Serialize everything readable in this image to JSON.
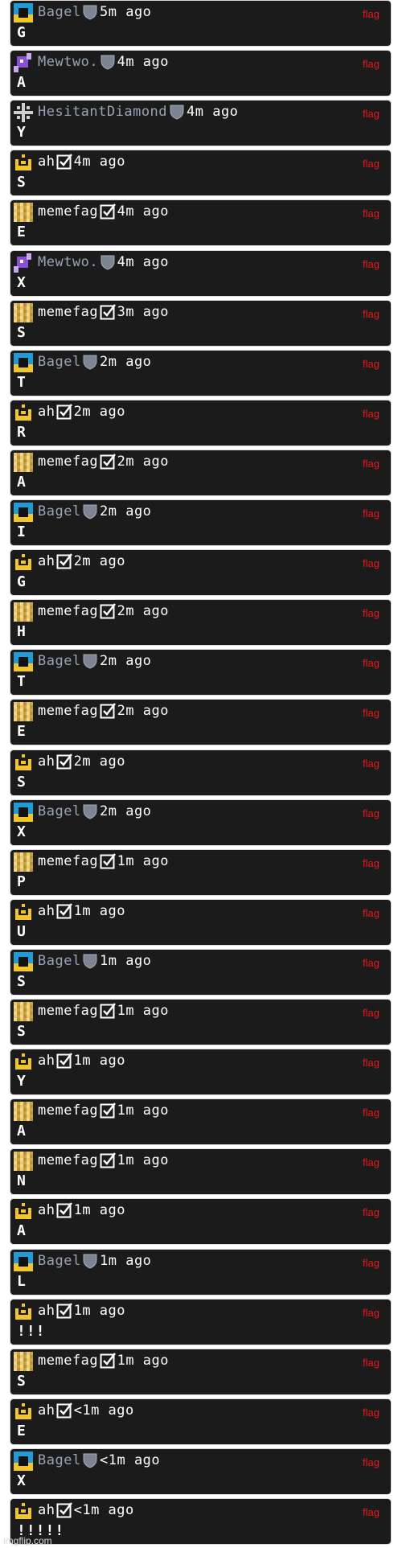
{
  "flag_label": "flag",
  "watermark": "imgflip.com",
  "colors": {
    "row_bg": "#1b1b1c",
    "row_border": "#d9d9d9",
    "flag": "#e61a1a",
    "anon_name": "#9aa3b5",
    "verified_name": "#ffffff",
    "bagel_avatar": "#1f9bd8",
    "crown_avatar": "#f2c52b",
    "memefag_avatar": "#d9b24a",
    "mewtwo_avatar": "#8a4fd8"
  },
  "messages": [
    {
      "user": "Bagel",
      "avatar": "bagel-icon",
      "badge": "shield-icon",
      "time": "5m ago",
      "text": "G"
    },
    {
      "user": "Mewtwo.",
      "avatar": "mewtwo-icon",
      "badge": "shield-icon",
      "time": "4m ago",
      "text": "A"
    },
    {
      "user": "HesitantDiamond",
      "avatar": "diamond-cross-icon",
      "badge": "shield-icon",
      "time": "4m ago",
      "text": "Y"
    },
    {
      "user": "ah",
      "avatar": "crown-icon",
      "badge": "check-icon",
      "time": "4m ago",
      "text": "S"
    },
    {
      "user": "memefag",
      "avatar": "memefag-icon",
      "badge": "check-icon",
      "time": "4m ago",
      "text": "E"
    },
    {
      "user": "Mewtwo.",
      "avatar": "mewtwo-icon",
      "badge": "shield-icon",
      "time": "4m ago",
      "text": "X"
    },
    {
      "user": "memefag",
      "avatar": "memefag-icon",
      "badge": "check-icon",
      "time": "3m ago",
      "text": "S"
    },
    {
      "user": "Bagel",
      "avatar": "bagel-icon",
      "badge": "shield-icon",
      "time": "2m ago",
      "text": "T"
    },
    {
      "user": "ah",
      "avatar": "crown-icon",
      "badge": "check-icon",
      "time": "2m ago",
      "text": "R"
    },
    {
      "user": "memefag",
      "avatar": "memefag-icon",
      "badge": "check-icon",
      "time": "2m ago",
      "text": "A"
    },
    {
      "user": "Bagel",
      "avatar": "bagel-icon",
      "badge": "shield-icon",
      "time": "2m ago",
      "text": "I"
    },
    {
      "user": "ah",
      "avatar": "crown-icon",
      "badge": "check-icon",
      "time": "2m ago",
      "text": "G"
    },
    {
      "user": "memefag",
      "avatar": "memefag-icon",
      "badge": "check-icon",
      "time": "2m ago",
      "text": "H"
    },
    {
      "user": "Bagel",
      "avatar": "bagel-icon",
      "badge": "shield-icon",
      "time": "2m ago",
      "text": "T"
    },
    {
      "user": "memefag",
      "avatar": "memefag-icon",
      "badge": "check-icon",
      "time": "2m ago",
      "text": "E"
    },
    {
      "user": "ah",
      "avatar": "crown-icon",
      "badge": "check-icon",
      "time": "2m ago",
      "text": "S"
    },
    {
      "user": "Bagel",
      "avatar": "bagel-icon",
      "badge": "shield-icon",
      "time": "2m ago",
      "text": "X"
    },
    {
      "user": "memefag",
      "avatar": "memefag-icon",
      "badge": "check-icon",
      "time": "1m ago",
      "text": "P"
    },
    {
      "user": "ah",
      "avatar": "crown-icon",
      "badge": "check-icon",
      "time": "1m ago",
      "text": "U"
    },
    {
      "user": "Bagel",
      "avatar": "bagel-icon",
      "badge": "shield-icon",
      "time": "1m ago",
      "text": "S"
    },
    {
      "user": "memefag",
      "avatar": "memefag-icon",
      "badge": "check-icon",
      "time": "1m ago",
      "text": "S"
    },
    {
      "user": "ah",
      "avatar": "crown-icon",
      "badge": "check-icon",
      "time": "1m ago",
      "text": "Y"
    },
    {
      "user": "memefag",
      "avatar": "memefag-icon",
      "badge": "check-icon",
      "time": "1m ago",
      "text": "A"
    },
    {
      "user": "memefag",
      "avatar": "memefag-icon",
      "badge": "check-icon",
      "time": "1m ago",
      "text": "N"
    },
    {
      "user": "ah",
      "avatar": "crown-icon",
      "badge": "check-icon",
      "time": "1m ago",
      "text": "A"
    },
    {
      "user": "Bagel",
      "avatar": "bagel-icon",
      "badge": "shield-icon",
      "time": "1m ago",
      "text": "L"
    },
    {
      "user": "ah",
      "avatar": "crown-icon",
      "badge": "check-icon",
      "time": "1m ago",
      "text": "!!!"
    },
    {
      "user": "memefag",
      "avatar": "memefag-icon",
      "badge": "check-icon",
      "time": "1m ago",
      "text": "S"
    },
    {
      "user": "ah",
      "avatar": "crown-icon",
      "badge": "check-icon",
      "time": "<1m ago",
      "text": "E"
    },
    {
      "user": "Bagel",
      "avatar": "bagel-icon",
      "badge": "shield-icon",
      "time": "<1m ago",
      "text": "X"
    },
    {
      "user": "ah",
      "avatar": "crown-icon",
      "badge": "check-icon",
      "time": "<1m ago",
      "text": "!!!!!"
    }
  ]
}
